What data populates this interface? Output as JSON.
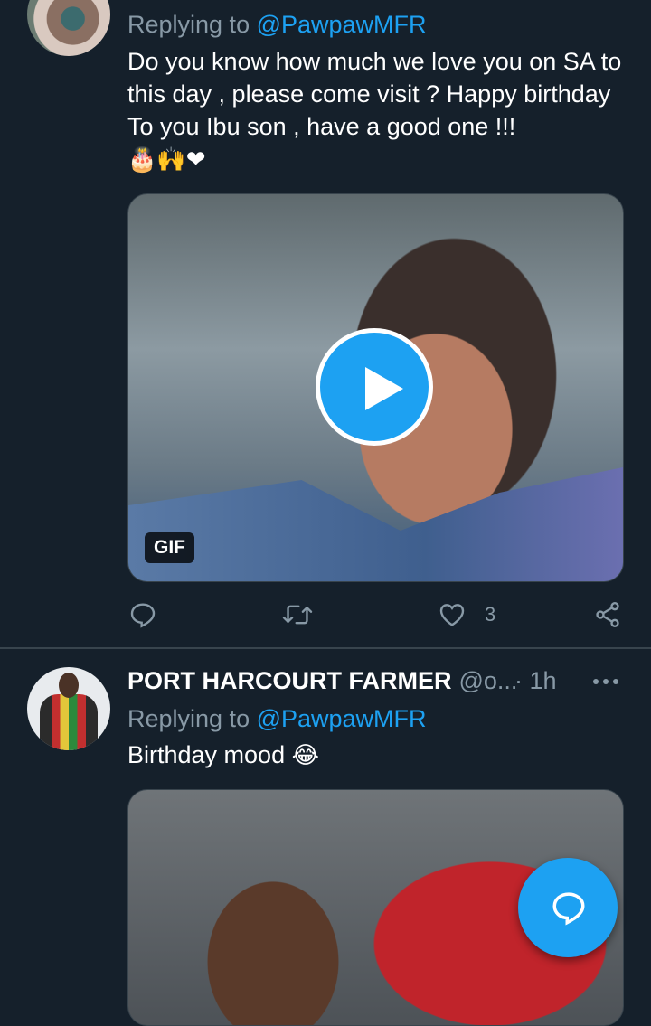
{
  "tweet1": {
    "replying_prefix": "Replying to ",
    "replying_handle": "@PawpawMFR",
    "text": "Do you know how much we love you on SA to this day , please come visit ? Happy birthday To you Ibu son , have a good one !!!",
    "emojis": "🎂🙌❤",
    "media_badge": "GIF",
    "like_count": "3"
  },
  "tweet2": {
    "name": "PORT HARCOURT FARMER",
    "username": "@o...",
    "time": "· 1h",
    "replying_prefix": "Replying to ",
    "replying_handle": "@PawpawMFR",
    "text": "Birthday mood",
    "emoji": "😂"
  },
  "icons": [
    "reply-icon",
    "retweet-icon",
    "like-icon",
    "share-icon",
    "more-icon",
    "play-icon",
    "compose-reply-icon"
  ],
  "colors": {
    "background": "#15202b",
    "accent": "#1da1f2",
    "secondary_text": "#8899a6",
    "divider": "#38444d"
  }
}
